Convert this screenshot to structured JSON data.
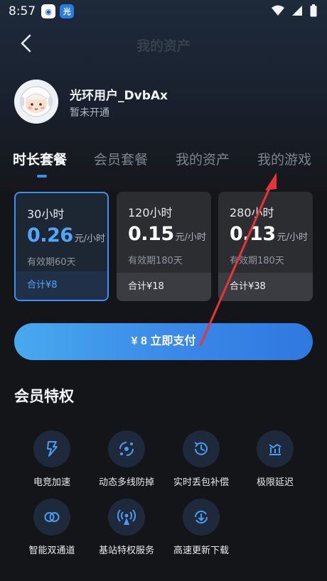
{
  "status_bar": {
    "time": "8:57",
    "app_icons": [
      {
        "name": "blue-app-icon",
        "glyph": "◉"
      },
      {
        "name": "guanghuan-app-icon",
        "glyph": "光"
      }
    ]
  },
  "nav": {
    "title": "我的资产"
  },
  "profile": {
    "username": "光环用户_DvbAx",
    "status": "暂未开通"
  },
  "tabs": [
    {
      "label": "时长套餐",
      "active": true
    },
    {
      "label": "会员套餐",
      "active": false
    },
    {
      "label": "我的资产",
      "active": false
    },
    {
      "label": "我的游戏",
      "active": false
    }
  ],
  "plans": [
    {
      "hours": "30小时",
      "price": "0.26",
      "unit": "元/小时",
      "validity": "有效期60天",
      "total": "合计¥8",
      "selected": true
    },
    {
      "hours": "120小时",
      "price": "0.15",
      "unit": "元/小时",
      "validity": "有效期180天",
      "total": "合计¥18",
      "selected": false
    },
    {
      "hours": "280小时",
      "price": "0.13",
      "unit": "元/小时",
      "validity": "有效期180天",
      "total": "合计¥38",
      "selected": false
    }
  ],
  "pay_button": {
    "label": "¥ 8 立即支付"
  },
  "section": {
    "title": "会员特权"
  },
  "perks": [
    {
      "label": "电竞加速",
      "icon": "lightning-icon"
    },
    {
      "label": "动态多线防掉",
      "icon": "multiline-icon"
    },
    {
      "label": "实时丢包补偿",
      "icon": "clock-refresh-icon"
    },
    {
      "label": "极限延迟",
      "icon": "latency-chart-icon"
    },
    {
      "label": "智能双通道",
      "icon": "dual-channel-icon"
    },
    {
      "label": "基站特权服务",
      "icon": "signal-tower-icon"
    },
    {
      "label": "高速更新下载",
      "icon": "download-refresh-icon"
    }
  ],
  "colors": {
    "accent": "#3b8ef0",
    "background": "#141518",
    "card": "#2b2d31",
    "annotation_arrow": "#e8333a"
  }
}
